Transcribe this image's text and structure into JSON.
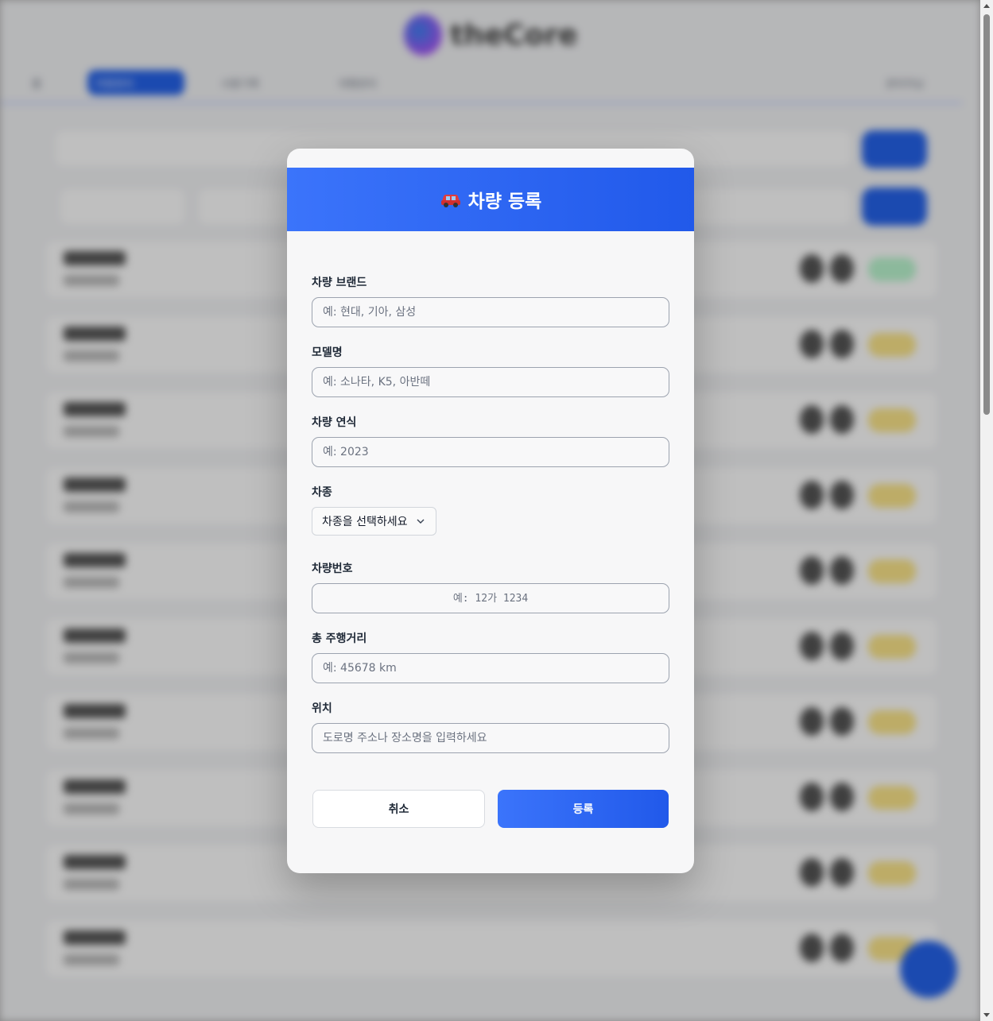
{
  "background_app": {
    "logo_text": "theCore",
    "tabs": [
      "홈",
      "차량관리",
      "사용기록",
      "대행관리"
    ],
    "user_label": "관리자님"
  },
  "modal": {
    "title": "차량 등록",
    "title_icon": "car-icon",
    "fields": {
      "brand": {
        "label": "차량 브랜드",
        "placeholder": "예: 현대, 기아, 삼성",
        "value": ""
      },
      "model": {
        "label": "모델명",
        "placeholder": "예: 소나타, K5, 아반떼",
        "value": ""
      },
      "year": {
        "label": "차량 연식",
        "placeholder": "예: 2023",
        "value": ""
      },
      "type": {
        "label": "차종",
        "selected": "차종을 선택하세요"
      },
      "plate": {
        "label": "차량번호",
        "placeholder": "예: 12가 1234",
        "value": ""
      },
      "mileage": {
        "label": "총 주행거리",
        "placeholder": "예: 45678 km",
        "value": ""
      },
      "location": {
        "label": "위치",
        "placeholder": "도로명 주소나 장소명을 입력하세요",
        "value": ""
      }
    },
    "buttons": {
      "cancel": "취소",
      "submit": "등록"
    }
  },
  "colors": {
    "accent": "#2563eb",
    "header_start": "#3b74fb",
    "header_end": "#2159ea"
  }
}
